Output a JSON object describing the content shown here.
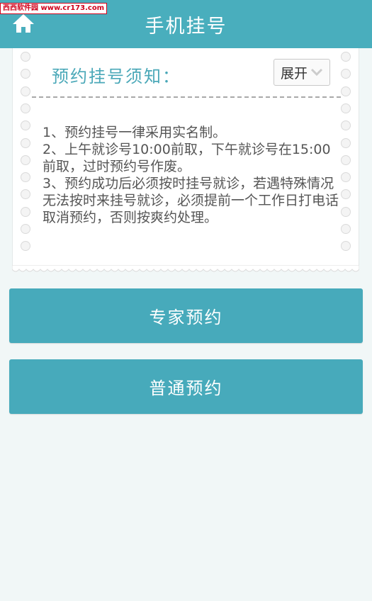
{
  "watermark": "西西软件园 www.cr173.com",
  "header": {
    "title": "手机挂号",
    "home_icon": "home-icon"
  },
  "notice": {
    "title": "预约挂号须知：",
    "expand_label": "展开",
    "expand_icon": "chevron-down-icon",
    "rules": [
      "1、预约挂号一律采用实名制。",
      "2、上午就诊号10:00前取，下午就诊号在15:00前取，过时预约号作废。",
      "3、预约成功后必须按时挂号就诊，若遇特殊情况无法按时来挂号就诊，必须提前一个工作日打电话取消预约，否则按爽约处理。"
    ]
  },
  "buttons": {
    "expert": "专家预约",
    "normal": "普通预约"
  },
  "colors": {
    "accent": "#49aebd",
    "button": "#47aabb",
    "background": "#f1f7f7",
    "notice_title": "#4aa8b8"
  }
}
